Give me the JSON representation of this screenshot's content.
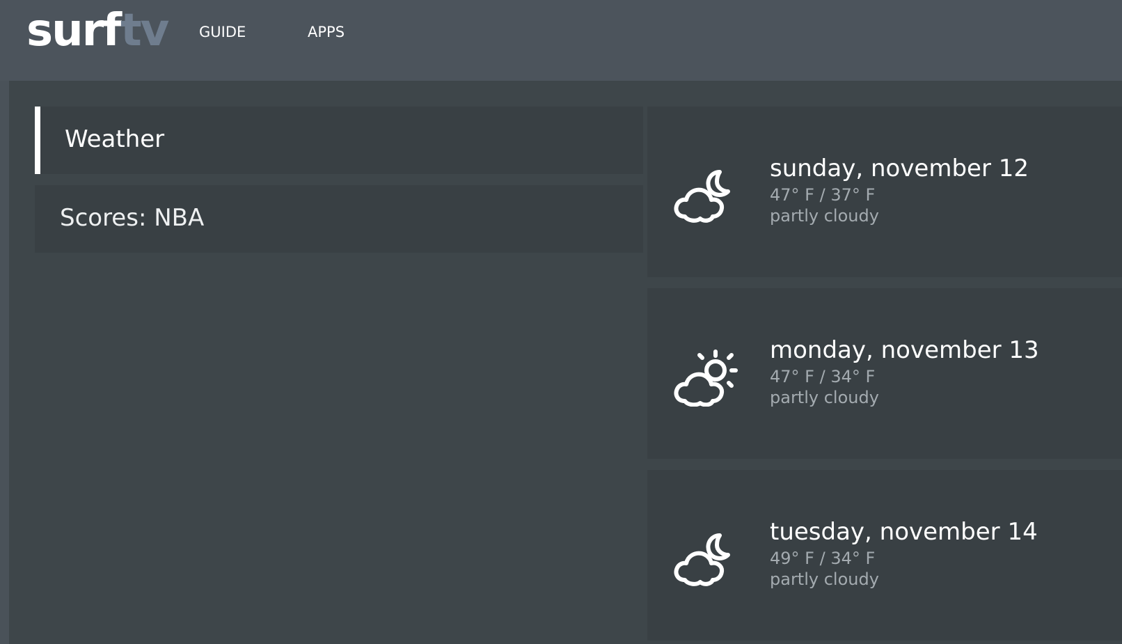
{
  "app": {
    "logo_primary": "surf",
    "logo_secondary": "tv",
    "logo_secondary_color": "#6f7d8e"
  },
  "nav": {
    "guide_label": "GUIDE",
    "apps_label": "APPS"
  },
  "menu": {
    "items": [
      {
        "label": "Weather",
        "selected": true
      },
      {
        "label": "Scores: NBA",
        "selected": false
      }
    ]
  },
  "forecast": [
    {
      "date": "sunday, november 12",
      "temps": "47° F / 37° F",
      "condition": "partly cloudy",
      "icon": "cloud-moon-icon"
    },
    {
      "date": "monday, november 13",
      "temps": "47° F / 34° F",
      "condition": "partly cloudy",
      "icon": "cloud-sun-icon"
    },
    {
      "date": "tuesday, november 14",
      "temps": "49° F / 34° F",
      "condition": "partly cloudy",
      "icon": "cloud-moon-icon"
    }
  ]
}
